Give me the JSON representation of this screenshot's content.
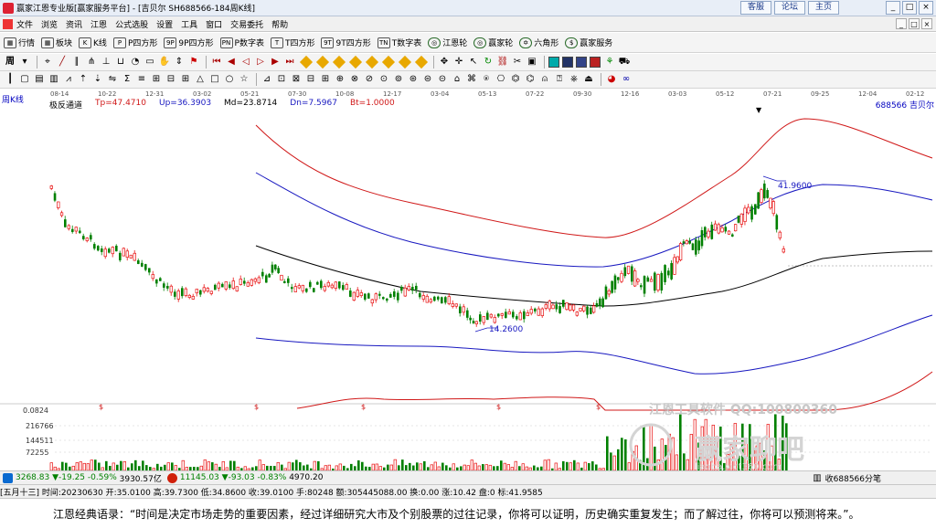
{
  "window": {
    "title": "赢家江恩专业版[赢家服务平台] - [吉贝尔  SH688566-184周K线]",
    "links": [
      "客服",
      "论坛",
      "主页"
    ],
    "controls": [
      "_",
      "□",
      "×"
    ]
  },
  "menu": {
    "items": [
      "文件",
      "浏览",
      "资讯",
      "江恩",
      "公式选股",
      "设置",
      "工具",
      "窗口",
      "交易委托",
      "帮助"
    ],
    "mdi_controls": [
      "_",
      "□",
      "×"
    ]
  },
  "toolbar1": {
    "items": [
      {
        "icon": "grid-icon",
        "glyph": "▦",
        "label": "行情"
      },
      {
        "icon": "board-icon",
        "glyph": "▦",
        "label": "板块"
      },
      {
        "icon": "kline-icon",
        "glyph": "K",
        "label": "K线"
      },
      {
        "icon": "p-square-icon",
        "glyph": "P",
        "label": "P四方形"
      },
      {
        "icon": "9p-square-icon",
        "glyph": "9P",
        "label": "9P四方形"
      },
      {
        "icon": "pn-icon",
        "glyph": "PN",
        "label": "P数字表"
      },
      {
        "icon": "t-square-icon",
        "glyph": "T",
        "label": "T四方形"
      },
      {
        "icon": "9t-square-icon",
        "glyph": "9T",
        "label": "9T四方形"
      },
      {
        "icon": "tn-icon",
        "glyph": "TN",
        "label": "T数字表"
      },
      {
        "icon": "gann-wheel-icon",
        "glyph": "◎",
        "label": "江恩轮"
      },
      {
        "icon": "winner-wheel-icon",
        "glyph": "◎",
        "label": "赢家轮"
      },
      {
        "icon": "hexagon-icon",
        "glyph": "✡",
        "label": "六角形"
      },
      {
        "icon": "dollar-icon",
        "glyph": "$",
        "label": "赢家服务"
      }
    ]
  },
  "toolbar2_glyph": "周",
  "chart": {
    "period_label": "周K线",
    "time_labels": [
      "08-14",
      "10-22",
      "12-31",
      "03-02",
      "05-21",
      "07-30",
      "10-08",
      "12-17",
      "03-04",
      "05-13",
      "07-22",
      "09-30",
      "12-16",
      "03-03",
      "05-12",
      "07-21",
      "09-25",
      "12-04",
      "02-12"
    ],
    "indicator": {
      "name": "极反通道",
      "tp": "Tp=47.4710",
      "up": "Up=36.3903",
      "md": "Md=23.8714",
      "dn": "Dn=7.5967",
      "bt": "Bt=1.0000"
    },
    "stock_id": "688566  吉贝尔",
    "annotations": {
      "high": "41.9600",
      "low": "14.2600"
    },
    "lower_panel": {
      "top_value": "0.0824",
      "y_ticks": [
        "216766",
        "144511",
        "72255"
      ],
      "watermark_line1": "江恩工具软件 QQ:100800360",
      "watermark_line2": "赢家聊吧",
      "watermark_url": "liaoba.vict360.com"
    },
    "colors": {
      "red": "#d01818",
      "blue": "#1818c0",
      "black": "#000000",
      "up_candle": "#e81010",
      "down_candle": "#008000"
    }
  },
  "index_bar": {
    "sh": {
      "value": "3268.83",
      "change": "▼-19.25",
      "pct": "-0.59%",
      "amount": "3930.57亿"
    },
    "sz": {
      "value": "11145.03",
      "change": "▼-93.03",
      "pct": "-0.83%",
      "amount": "4970.20"
    },
    "right_text": "收688566分笔"
  },
  "status_bar": {
    "text": "[五月十三] 时间:20230630 开:35.0100 高:39.7300 低:34.8600 收:39.0100 手:80248 额:305445088.00 换:0.00 涨:10.42 盘:0 标:41.9585"
  },
  "quote_bar": {
    "text": "江恩经典语录：“时间是决定市场走势的重要因素，经过详细研究大市及个别股票的过往记录，你将可以证明，历史确实重复发生；而了解过往，你将可以预测将来。”。"
  }
}
